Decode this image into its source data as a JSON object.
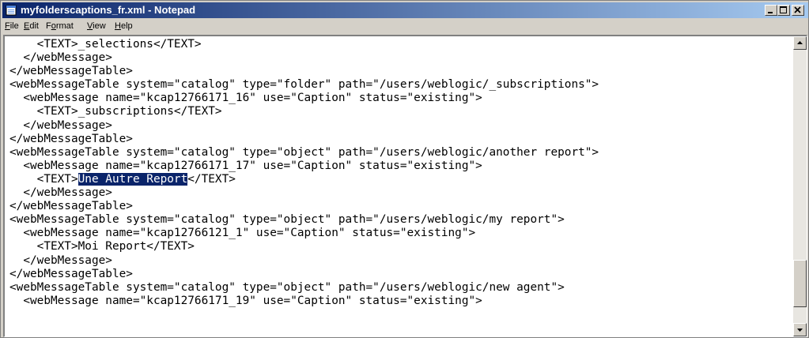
{
  "window": {
    "title": "myfolderscaptions_fr.xml - Notepad"
  },
  "menu": [
    {
      "pre": "",
      "u": "F",
      "post": "ile"
    },
    {
      "pre": "",
      "u": "E",
      "post": "dit"
    },
    {
      "pre": "F",
      "u": "o",
      "post": "rmat"
    },
    {
      "pre": "",
      "u": "V",
      "post": "iew"
    },
    {
      "pre": "",
      "u": "H",
      "post": "elp"
    }
  ],
  "editor": {
    "lines": [
      {
        "pre": "    <TEXT>_selections</TEXT>",
        "sel": "",
        "post": ""
      },
      {
        "pre": "  </webMessage>",
        "sel": "",
        "post": ""
      },
      {
        "pre": "</webMessageTable>",
        "sel": "",
        "post": ""
      },
      {
        "pre": "<webMessageTable system=\"catalog\" type=\"folder\" path=\"/users/weblogic/_subscriptions\">",
        "sel": "",
        "post": ""
      },
      {
        "pre": "  <webMessage name=\"kcap12766171_16\" use=\"Caption\" status=\"existing\">",
        "sel": "",
        "post": ""
      },
      {
        "pre": "    <TEXT>_subscriptions</TEXT>",
        "sel": "",
        "post": ""
      },
      {
        "pre": "  </webMessage>",
        "sel": "",
        "post": ""
      },
      {
        "pre": "</webMessageTable>",
        "sel": "",
        "post": ""
      },
      {
        "pre": "<webMessageTable system=\"catalog\" type=\"object\" path=\"/users/weblogic/another report\">",
        "sel": "",
        "post": ""
      },
      {
        "pre": "  <webMessage name=\"kcap12766171_17\" use=\"Caption\" status=\"existing\">",
        "sel": "",
        "post": ""
      },
      {
        "pre": "    <TEXT>",
        "sel": "Une Autre Report",
        "post": "</TEXT>"
      },
      {
        "pre": "  </webMessage>",
        "sel": "",
        "post": ""
      },
      {
        "pre": "</webMessageTable>",
        "sel": "",
        "post": ""
      },
      {
        "pre": "<webMessageTable system=\"catalog\" type=\"object\" path=\"/users/weblogic/my report\">",
        "sel": "",
        "post": ""
      },
      {
        "pre": "  <webMessage name=\"kcap12766121_1\" use=\"Caption\" status=\"existing\">",
        "sel": "",
        "post": ""
      },
      {
        "pre": "    <TEXT>Moi Report</TEXT>",
        "sel": "",
        "post": ""
      },
      {
        "pre": "  </webMessage>",
        "sel": "",
        "post": ""
      },
      {
        "pre": "</webMessageTable>",
        "sel": "",
        "post": ""
      },
      {
        "pre": "<webMessageTable system=\"catalog\" type=\"object\" path=\"/users/weblogic/new agent\">",
        "sel": "",
        "post": ""
      },
      {
        "pre": "  <webMessage name=\"kcap12766171_19\" use=\"Caption\" status=\"existing\">",
        "sel": "",
        "post": ""
      }
    ]
  },
  "icons": {
    "app": "notepad-icon",
    "minimize": "minimize-icon",
    "maximize": "maximize-icon",
    "close": "close-icon",
    "scroll_up": "scroll-up-arrow-icon",
    "scroll_down": "scroll-down-arrow-icon"
  },
  "colors": {
    "titlebar_start": "#0a246a",
    "titlebar_end": "#a6caf0",
    "selection_bg": "#0a246a",
    "chrome": "#d4d0c8"
  }
}
